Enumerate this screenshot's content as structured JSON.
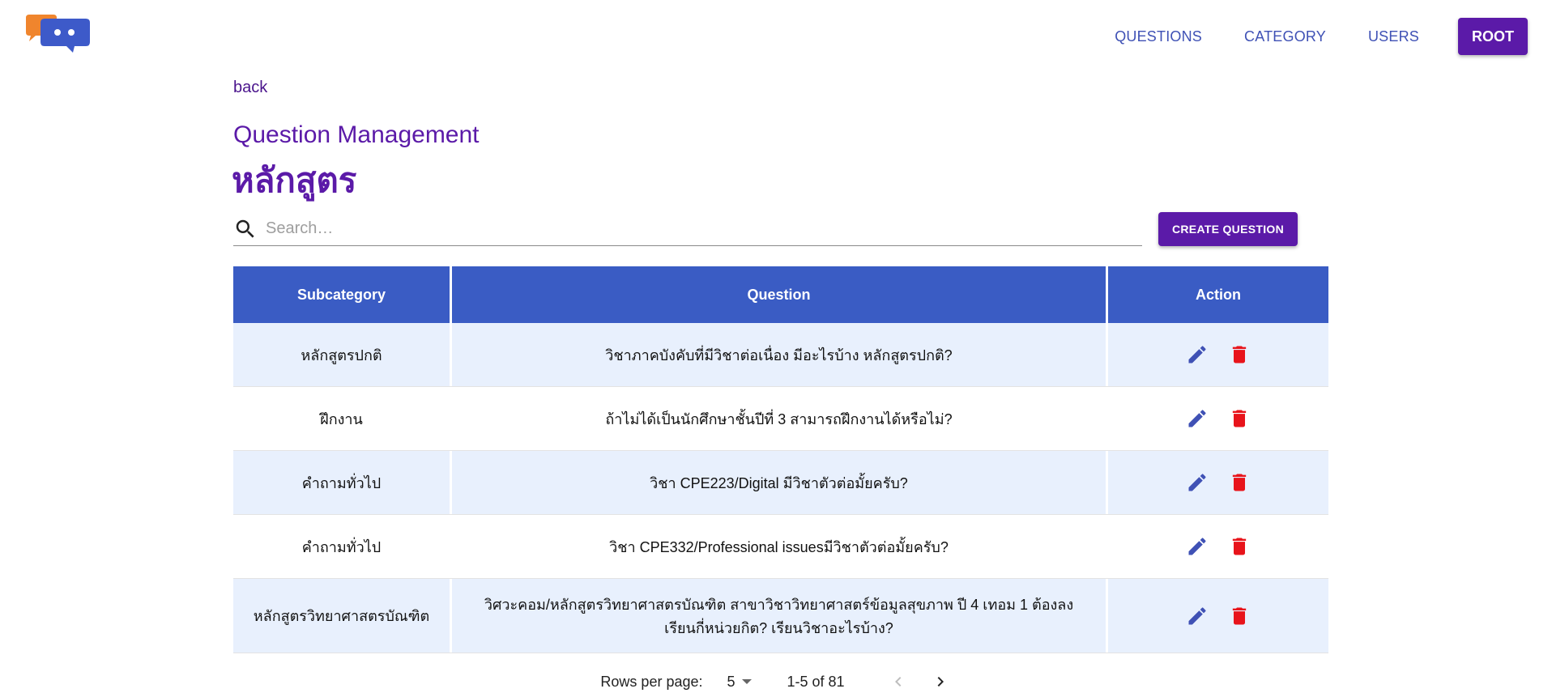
{
  "header": {
    "logo": "chat-bubbles-logo",
    "nav": {
      "questions": "QUESTIONS",
      "category": "CATEGORY",
      "users": "USERS",
      "root": "ROOT"
    }
  },
  "page": {
    "back": "back",
    "title": "Question Management",
    "category": "หลักสูตร"
  },
  "search": {
    "placeholder": "Search…",
    "value": ""
  },
  "create_button": "CREATE QUESTION",
  "table": {
    "headers": [
      "Subcategory",
      "Question",
      "Action"
    ],
    "rows": [
      {
        "subcategory": "หลักสูตรปกติ",
        "question": "วิชาภาคบังคับที่มีวิชาต่อเนื่อง มีอะไรบ้าง หลักสูตรปกติ?"
      },
      {
        "subcategory": "ฝึกงาน",
        "question": "ถ้าไม่ได้เป็นนักศึกษาชั้นปีที่ 3 สามารถฝึกงานได้หรือไม่?"
      },
      {
        "subcategory": "คำถามทั่วไป",
        "question": "วิชา CPE223/Digital มีวิชาตัวต่อมั้ยครับ?"
      },
      {
        "subcategory": "คำถามทั่วไป",
        "question": "วิชา CPE332/Professional issuesมีวิชาตัวต่อมั้ยครับ?"
      },
      {
        "subcategory": "หลักสูตรวิทยาศาสตรบัณฑิต",
        "question": "วิศวะคอม/หลักสูตรวิทยาศาสตรบัณฑิต สาขาวิชาวิทยาศาสตร์ข้อมูลสุขภาพ ปี 4 เทอม 1 ต้องลงเรียนกี่หน่วยกิต? เรียนวิชาอะไรบ้าง?"
      }
    ]
  },
  "pagination": {
    "rows_per_page_label": "Rows per page:",
    "rows_per_page": "5",
    "range": "1-5 of 81"
  },
  "colors": {
    "primary": "#5b1aa8",
    "header_row": "#3a5cc4",
    "shaded_row": "#e8f0fd",
    "edit_icon": "#3f51b5",
    "delete_icon": "#e8141b"
  }
}
